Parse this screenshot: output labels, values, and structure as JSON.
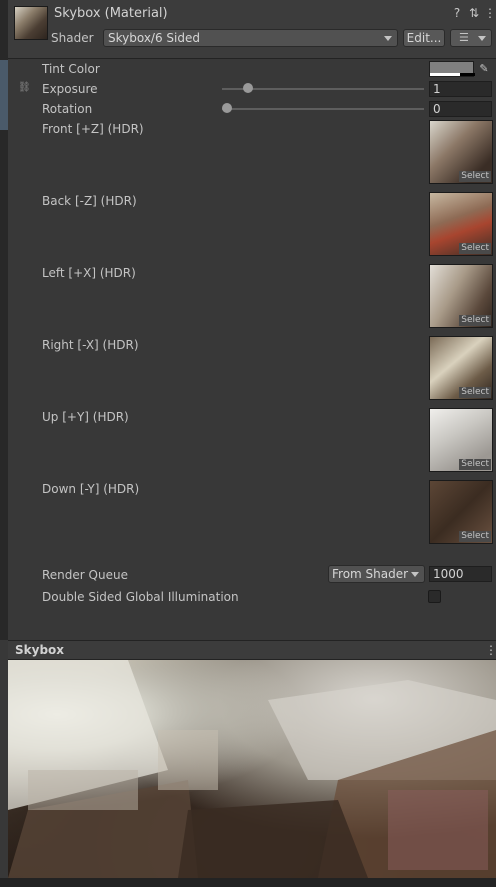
{
  "header": {
    "title": "Skybox (Material)",
    "shader_label": "Shader",
    "shader_value": "Skybox/6 Sided",
    "edit_label": "Edit...",
    "help_icon": "help-icon",
    "settings_icon": "preset-icon",
    "menu_icon": "kebab-menu-icon"
  },
  "properties": {
    "tint_color": {
      "label": "Tint Color",
      "color": "#808080"
    },
    "exposure": {
      "label": "Exposure",
      "value": "1",
      "fraction": 0.13
    },
    "rotation": {
      "label": "Rotation",
      "value": "0",
      "fraction": 0.0
    }
  },
  "textures": [
    {
      "label": "Front [+Z]   (HDR)",
      "select": "Select"
    },
    {
      "label": "Back [-Z]   (HDR)",
      "select": "Select"
    },
    {
      "label": "Left [+X]   (HDR)",
      "select": "Select"
    },
    {
      "label": "Right [-X]   (HDR)",
      "select": "Select"
    },
    {
      "label": "Up [+Y]   (HDR)",
      "select": "Select"
    },
    {
      "label": "Down [-Y]   (HDR)",
      "select": "Select"
    }
  ],
  "render_queue": {
    "label": "Render Queue",
    "mode": "From Shader",
    "value": "1000"
  },
  "double_sided_gi": {
    "label": "Double Sided Global Illumination",
    "checked": false
  },
  "preview": {
    "title": "Skybox"
  }
}
